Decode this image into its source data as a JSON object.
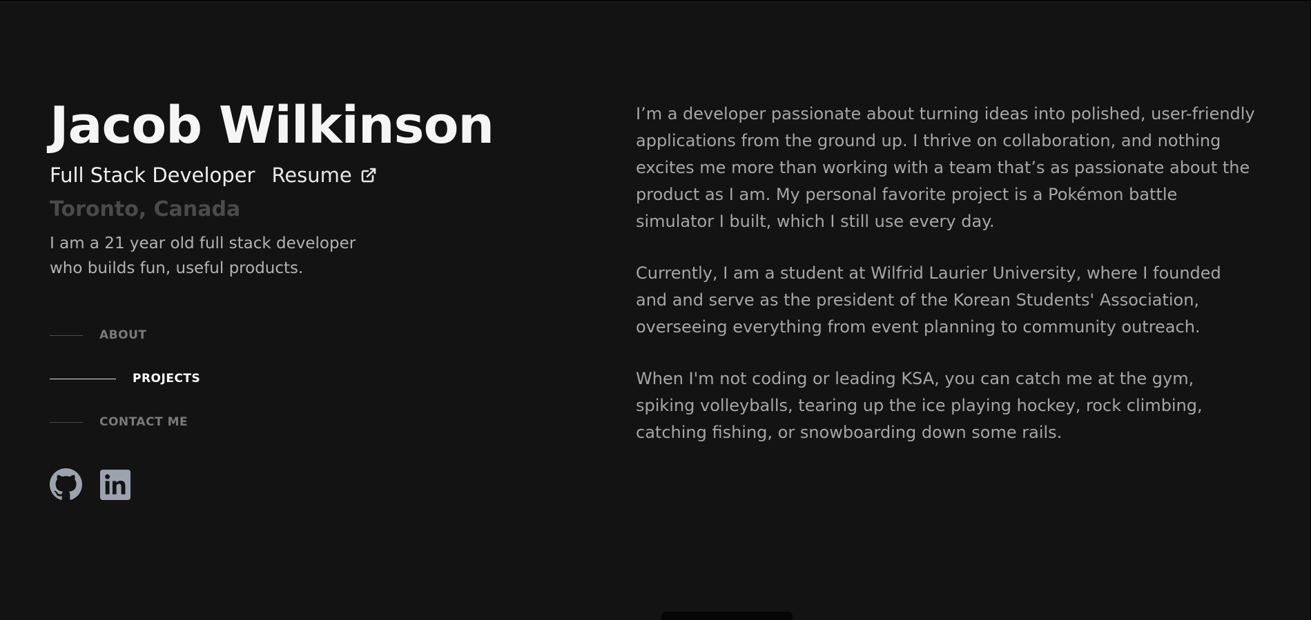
{
  "profile": {
    "name": "Jacob Wilkinson",
    "role": "Full Stack Developer",
    "resume_label": "Resume",
    "location": "Toronto, Canada",
    "tagline": "I am a 21 year old full stack developer who builds fun, useful products."
  },
  "nav": {
    "items": [
      {
        "label": "ABOUT",
        "active": false
      },
      {
        "label": "PROJECTS",
        "active": true
      },
      {
        "label": "CONTACT ME",
        "active": false
      }
    ]
  },
  "socials": {
    "icons": [
      "github-icon",
      "linkedin-icon"
    ]
  },
  "about": {
    "paragraphs": [
      "I’m a developer passionate about turning ideas into polished, user-friendly applications from the ground up. I thrive on collaboration, and nothing excites me more than working with a team that’s as passionate about the product as I am. My personal favorite project is a Pokémon battle simulator I built, which I still use every day.",
      "Currently, I am a student at Wilfrid Laurier University, where I founded and and serve as the president of the Korean Students' Association, overseeing everything from event planning to community outreach.",
      "When I'm not coding or leading KSA, you can catch me at the gym, spiking volleyballs, tearing up the ice playing hockey, rock climbing, catching fishing, or snowboarding down some rails."
    ]
  },
  "colors": {
    "background": "#131313",
    "heading": "#f5f5f5",
    "body_text": "#a6a6a6",
    "location": "#4a4a4a",
    "nav_active": "#ffffff",
    "nav_inactive": "#7a7a7a",
    "icon": "#9ca3af"
  }
}
